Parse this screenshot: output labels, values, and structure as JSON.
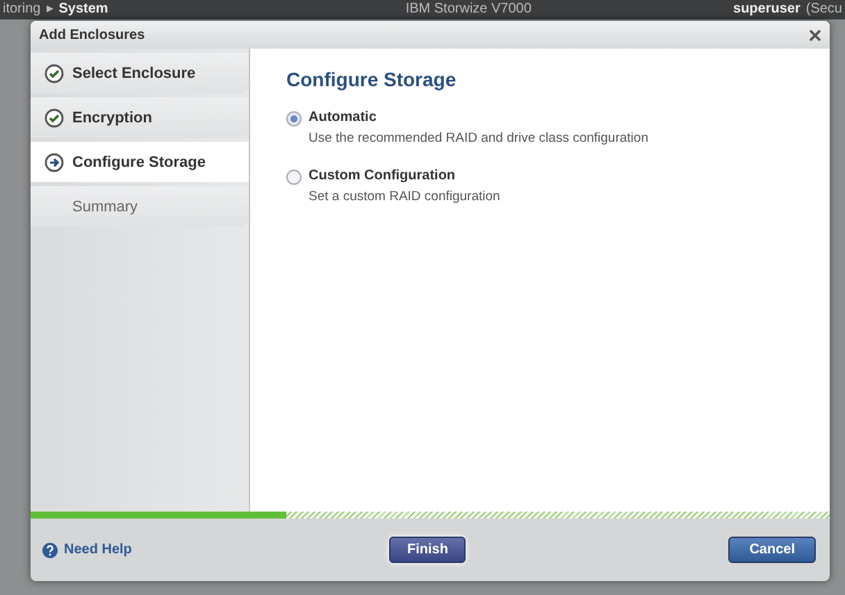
{
  "background_bar": {
    "breadcrumb": "itoring",
    "separator": "▸",
    "section": "System",
    "product": "IBM Storwize V7000",
    "user": "superuser",
    "user_role": "(Secu"
  },
  "dialog": {
    "title": "Add Enclosures",
    "steps": [
      {
        "label": "Select Enclosure",
        "kind": "done",
        "selected": false
      },
      {
        "label": "Encryption",
        "kind": "done",
        "selected": false
      },
      {
        "label": "Configure Storage",
        "kind": "current",
        "selected": true
      },
      {
        "label": "Summary",
        "kind": "pending",
        "selected": false
      }
    ],
    "heading": "Configure Storage",
    "options": [
      {
        "label": "Automatic",
        "description": "Use the recommended RAID and drive class configuration",
        "selected": true
      },
      {
        "label": "Custom Configuration",
        "description": "Set a custom RAID configuration",
        "selected": false
      }
    ],
    "progress": {
      "level": 0.32
    },
    "help_link": "Need Help",
    "buttons": [
      {
        "label": "Finish",
        "kind": "primary"
      },
      {
        "label": "Cancel",
        "kind": "secondary"
      }
    ]
  }
}
